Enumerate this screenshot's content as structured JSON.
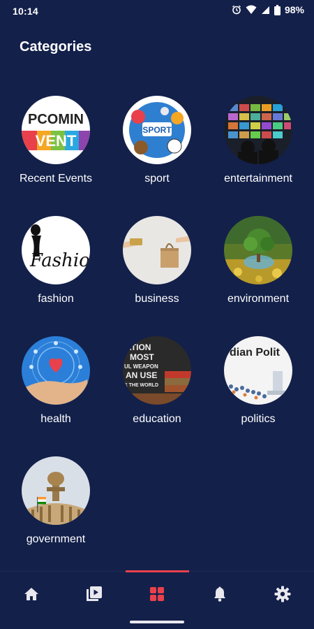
{
  "status_bar": {
    "time": "10:14",
    "battery": "98%"
  },
  "page": {
    "title": "Categories"
  },
  "categories": [
    {
      "label": "Recent  Events",
      "thumb_text_1": "PCOMIN",
      "thumb_text_2": "VENT"
    },
    {
      "label": "sport",
      "thumb_text_1": "SPORT"
    },
    {
      "label": "entertainment"
    },
    {
      "label": "fashion",
      "thumb_text_1": "Fashio"
    },
    {
      "label": "business"
    },
    {
      "label": "environment"
    },
    {
      "label": "health"
    },
    {
      "label": "education",
      "thumb_text_lines": [
        "ATION",
        "MOST",
        "UL WEAPON",
        "AN USE",
        "E THE WORLD"
      ]
    },
    {
      "label": "politics",
      "thumb_text_1": "dian Polit"
    },
    {
      "label": "government"
    }
  ],
  "bottom_nav": {
    "items": [
      "home-icon",
      "video-icon",
      "categories-icon",
      "notifications-icon",
      "settings-icon"
    ],
    "active": "categories-icon"
  },
  "colors": {
    "background": "#13204a",
    "accent": "#e8414b",
    "icon": "#e8e8ee"
  }
}
